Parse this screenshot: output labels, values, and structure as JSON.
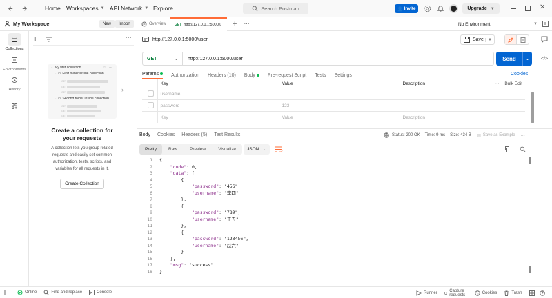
{
  "topbar": {
    "home": "Home",
    "workspaces": "Workspaces",
    "api_network": "API Network",
    "explore": "Explore",
    "search_placeholder": "Search Postman",
    "invite": "Invite",
    "upgrade": "Upgrade"
  },
  "sidebar": {
    "workspace_title": "My Workspace",
    "new_label": "New",
    "import_label": "Import",
    "rail": [
      {
        "label": "Collections"
      },
      {
        "label": "Environments"
      },
      {
        "label": "History"
      }
    ],
    "preview": {
      "collection": "My first collection",
      "folder1": "First folder inside collection",
      "folder2": "Second folder inside collection",
      "methods": [
        "GET",
        "GET",
        "GET",
        "GET",
        "GET",
        "GET"
      ]
    },
    "empty_title": "Create a collection for your requests",
    "empty_desc": "A collection lets you group related requests and easily set common authorization, tests, scripts, and variables for all requests in it.",
    "create_button": "Create Collection"
  },
  "tabs": {
    "overview": "Overview",
    "active_method": "GET",
    "active_url": "http://127.0.0.1:5000/u",
    "environment": "No Environment"
  },
  "request": {
    "title": "http://127.0.0.1:5000/user",
    "save": "Save",
    "method": "GET",
    "url": "http://127.0.0.1:5000/user",
    "send": "Send",
    "subtabs": [
      "Params",
      "Authorization",
      "Headers (10)",
      "Body",
      "Pre-request Script",
      "Tests",
      "Settings"
    ],
    "cookies": "Cookies",
    "params_headers": {
      "key": "Key",
      "value": "Value",
      "description": "Description",
      "bulk_edit": "Bulk Edit"
    },
    "params_rows": [
      {
        "key": "username",
        "value": "",
        "description": ""
      },
      {
        "key": "password",
        "value": "123",
        "description": ""
      },
      {
        "key": "Key",
        "value": "Value",
        "description": "Description"
      }
    ]
  },
  "response": {
    "tabs": [
      "Body",
      "Cookies",
      "Headers (5)",
      "Test Results"
    ],
    "status": "Status: 200 OK",
    "time": "Time: 9 ms",
    "size": "Size: 434 B",
    "save_example": "Save as Example",
    "views": [
      "Pretty",
      "Raw",
      "Preview",
      "Visualize"
    ],
    "format": "JSON",
    "lines": [
      "{",
      "    \"code\": 0,",
      "    \"data\": [",
      "        {",
      "            \"password\": \"456\",",
      "            \"username\": \"李四\"",
      "        },",
      "        {",
      "            \"password\": \"789\",",
      "            \"username\": \"王五\"",
      "        },",
      "        {",
      "            \"password\": \"123456\",",
      "            \"username\": \"赵六\"",
      "        }",
      "    ],",
      "    \"msg\": \"success\"",
      "}"
    ]
  },
  "statusbar": {
    "online": "Online",
    "find_replace": "Find and replace",
    "console": "Console",
    "runner": "Runner",
    "capture": "Capture requests",
    "cookies": "Cookies",
    "trash": "Trash"
  }
}
